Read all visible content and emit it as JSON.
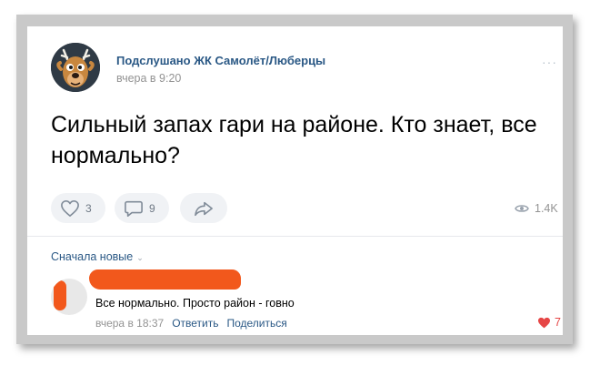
{
  "post": {
    "author": "Подслушано ЖК Самолёт/Люберцы",
    "time": "вчера в 9:20",
    "more_label": "···",
    "text": "Сильный запах гари на районе. Кто знает, все нормально?",
    "likes_count": "3",
    "comments_count": "9",
    "views_count": "1.4K"
  },
  "comments": {
    "sort_label": "Сначала новые",
    "items": [
      {
        "text": "Все нормально. Просто район - говно",
        "time": "вчера в 18:37",
        "reply_label": "Ответить",
        "share_label": "Поделиться",
        "likes_count": "7"
      }
    ]
  },
  "icons": {
    "like": "heart-outline-icon",
    "comment": "comment-bubble-icon",
    "share": "share-arrow-icon",
    "views": "eye-icon",
    "comment_like": "heart-filled-icon"
  },
  "colors": {
    "link": "#2a5885",
    "muted": "#939393",
    "pill_bg": "#f0f2f5",
    "like_red": "#e64646",
    "redaction": "#f2581c"
  }
}
